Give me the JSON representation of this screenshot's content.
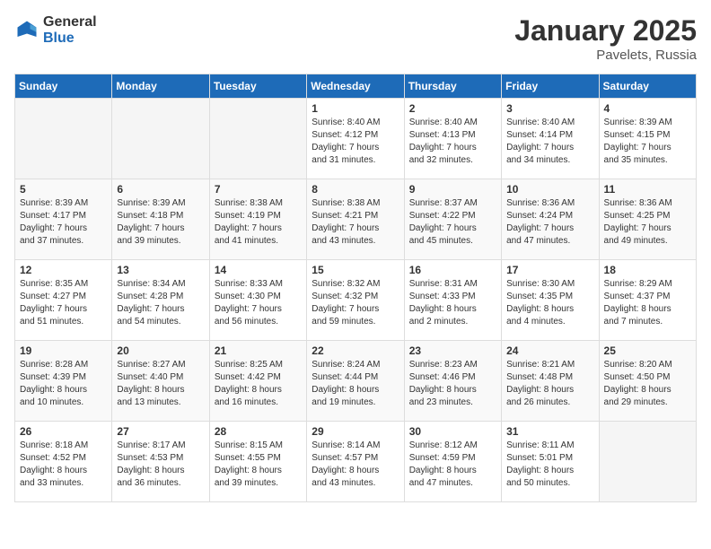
{
  "logo": {
    "general": "General",
    "blue": "Blue"
  },
  "title": "January 2025",
  "location": "Pavelets, Russia",
  "days_of_week": [
    "Sunday",
    "Monday",
    "Tuesday",
    "Wednesday",
    "Thursday",
    "Friday",
    "Saturday"
  ],
  "weeks": [
    [
      {
        "day": "",
        "content": ""
      },
      {
        "day": "",
        "content": ""
      },
      {
        "day": "",
        "content": ""
      },
      {
        "day": "1",
        "content": "Sunrise: 8:40 AM\nSunset: 4:12 PM\nDaylight: 7 hours\nand 31 minutes."
      },
      {
        "day": "2",
        "content": "Sunrise: 8:40 AM\nSunset: 4:13 PM\nDaylight: 7 hours\nand 32 minutes."
      },
      {
        "day": "3",
        "content": "Sunrise: 8:40 AM\nSunset: 4:14 PM\nDaylight: 7 hours\nand 34 minutes."
      },
      {
        "day": "4",
        "content": "Sunrise: 8:39 AM\nSunset: 4:15 PM\nDaylight: 7 hours\nand 35 minutes."
      }
    ],
    [
      {
        "day": "5",
        "content": "Sunrise: 8:39 AM\nSunset: 4:17 PM\nDaylight: 7 hours\nand 37 minutes."
      },
      {
        "day": "6",
        "content": "Sunrise: 8:39 AM\nSunset: 4:18 PM\nDaylight: 7 hours\nand 39 minutes."
      },
      {
        "day": "7",
        "content": "Sunrise: 8:38 AM\nSunset: 4:19 PM\nDaylight: 7 hours\nand 41 minutes."
      },
      {
        "day": "8",
        "content": "Sunrise: 8:38 AM\nSunset: 4:21 PM\nDaylight: 7 hours\nand 43 minutes."
      },
      {
        "day": "9",
        "content": "Sunrise: 8:37 AM\nSunset: 4:22 PM\nDaylight: 7 hours\nand 45 minutes."
      },
      {
        "day": "10",
        "content": "Sunrise: 8:36 AM\nSunset: 4:24 PM\nDaylight: 7 hours\nand 47 minutes."
      },
      {
        "day": "11",
        "content": "Sunrise: 8:36 AM\nSunset: 4:25 PM\nDaylight: 7 hours\nand 49 minutes."
      }
    ],
    [
      {
        "day": "12",
        "content": "Sunrise: 8:35 AM\nSunset: 4:27 PM\nDaylight: 7 hours\nand 51 minutes."
      },
      {
        "day": "13",
        "content": "Sunrise: 8:34 AM\nSunset: 4:28 PM\nDaylight: 7 hours\nand 54 minutes."
      },
      {
        "day": "14",
        "content": "Sunrise: 8:33 AM\nSunset: 4:30 PM\nDaylight: 7 hours\nand 56 minutes."
      },
      {
        "day": "15",
        "content": "Sunrise: 8:32 AM\nSunset: 4:32 PM\nDaylight: 7 hours\nand 59 minutes."
      },
      {
        "day": "16",
        "content": "Sunrise: 8:31 AM\nSunset: 4:33 PM\nDaylight: 8 hours\nand 2 minutes."
      },
      {
        "day": "17",
        "content": "Sunrise: 8:30 AM\nSunset: 4:35 PM\nDaylight: 8 hours\nand 4 minutes."
      },
      {
        "day": "18",
        "content": "Sunrise: 8:29 AM\nSunset: 4:37 PM\nDaylight: 8 hours\nand 7 minutes."
      }
    ],
    [
      {
        "day": "19",
        "content": "Sunrise: 8:28 AM\nSunset: 4:39 PM\nDaylight: 8 hours\nand 10 minutes."
      },
      {
        "day": "20",
        "content": "Sunrise: 8:27 AM\nSunset: 4:40 PM\nDaylight: 8 hours\nand 13 minutes."
      },
      {
        "day": "21",
        "content": "Sunrise: 8:25 AM\nSunset: 4:42 PM\nDaylight: 8 hours\nand 16 minutes."
      },
      {
        "day": "22",
        "content": "Sunrise: 8:24 AM\nSunset: 4:44 PM\nDaylight: 8 hours\nand 19 minutes."
      },
      {
        "day": "23",
        "content": "Sunrise: 8:23 AM\nSunset: 4:46 PM\nDaylight: 8 hours\nand 23 minutes."
      },
      {
        "day": "24",
        "content": "Sunrise: 8:21 AM\nSunset: 4:48 PM\nDaylight: 8 hours\nand 26 minutes."
      },
      {
        "day": "25",
        "content": "Sunrise: 8:20 AM\nSunset: 4:50 PM\nDaylight: 8 hours\nand 29 minutes."
      }
    ],
    [
      {
        "day": "26",
        "content": "Sunrise: 8:18 AM\nSunset: 4:52 PM\nDaylight: 8 hours\nand 33 minutes."
      },
      {
        "day": "27",
        "content": "Sunrise: 8:17 AM\nSunset: 4:53 PM\nDaylight: 8 hours\nand 36 minutes."
      },
      {
        "day": "28",
        "content": "Sunrise: 8:15 AM\nSunset: 4:55 PM\nDaylight: 8 hours\nand 39 minutes."
      },
      {
        "day": "29",
        "content": "Sunrise: 8:14 AM\nSunset: 4:57 PM\nDaylight: 8 hours\nand 43 minutes."
      },
      {
        "day": "30",
        "content": "Sunrise: 8:12 AM\nSunset: 4:59 PM\nDaylight: 8 hours\nand 47 minutes."
      },
      {
        "day": "31",
        "content": "Sunrise: 8:11 AM\nSunset: 5:01 PM\nDaylight: 8 hours\nand 50 minutes."
      },
      {
        "day": "",
        "content": ""
      }
    ]
  ]
}
